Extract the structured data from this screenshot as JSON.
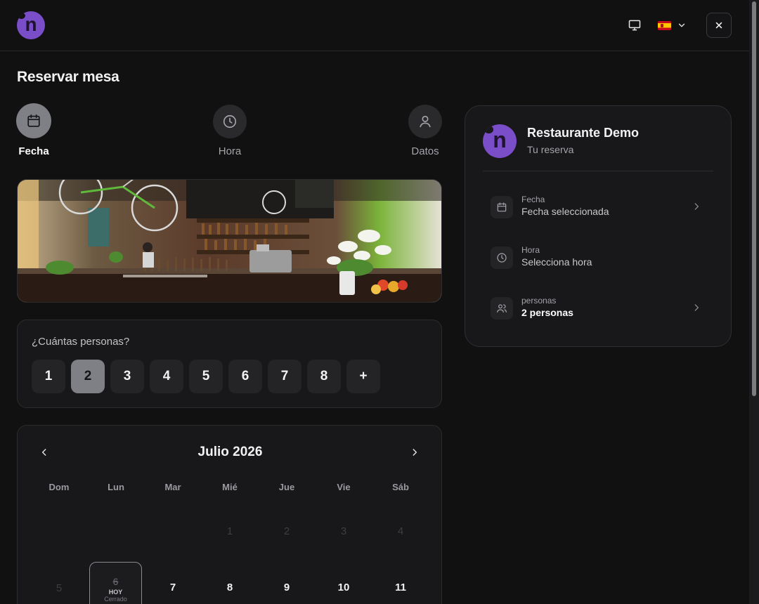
{
  "header": {
    "logo_letter": "n",
    "icons": {
      "display": "monitor-icon",
      "language_flag": "spain-flag-icon",
      "language_dropdown": "chevron-down-icon",
      "close": "close-icon"
    }
  },
  "page": {
    "title": "Reservar mesa"
  },
  "steps": [
    {
      "label": "Fecha",
      "icon": "calendar-icon",
      "active": true
    },
    {
      "label": "Hora",
      "icon": "clock-icon",
      "active": false
    },
    {
      "label": "Datos",
      "icon": "user-icon",
      "active": false
    }
  ],
  "party": {
    "question": "¿Cuántas personas?",
    "options": [
      "1",
      "2",
      "3",
      "4",
      "5",
      "6",
      "7",
      "8",
      "+"
    ],
    "selected": "2"
  },
  "calendar": {
    "month_label": "Julio 2026",
    "weekdays": [
      "Dom",
      "Lun",
      "Mar",
      "Mié",
      "Jue",
      "Vie",
      "Sáb"
    ],
    "week1": [
      "1",
      "2",
      "3",
      "4"
    ],
    "week2": {
      "sun": "5",
      "today_number": "6",
      "today_label": "HOY",
      "today_status": "Cerrado",
      "rest": [
        "7",
        "8",
        "9",
        "10",
        "11"
      ]
    }
  },
  "summary": {
    "logo_letter": "n",
    "restaurant_name": "Restaurante Demo",
    "subtitle": "Tu reserva",
    "rows": [
      {
        "key": "Fecha",
        "value": "Fecha seleccionada",
        "icon": "calendar-icon"
      },
      {
        "key": "Hora",
        "value": "Selecciona hora",
        "icon": "clock-icon"
      },
      {
        "key": "personas",
        "value": "2 personas",
        "icon": "users-icon"
      }
    ]
  },
  "colors": {
    "background": "#111112",
    "accent": "#7b4ec9",
    "card": "#18181a",
    "selected": "#7f7f86"
  }
}
